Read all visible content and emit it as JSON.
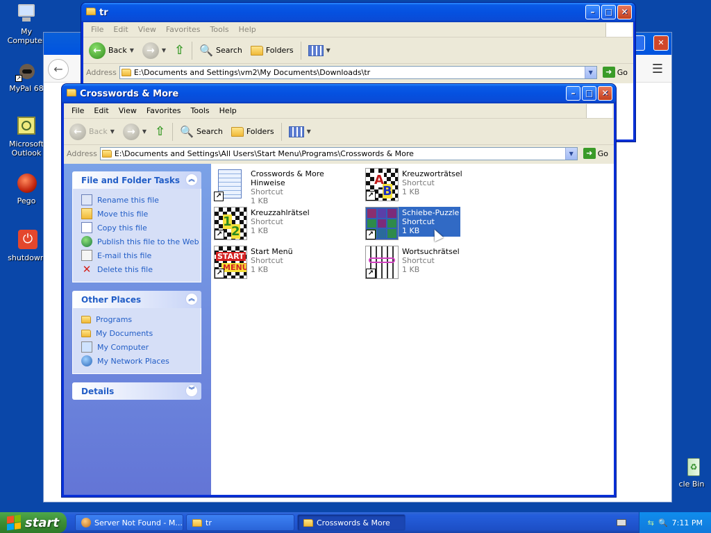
{
  "desktop": {
    "icons": [
      {
        "label": "My Computer"
      },
      {
        "label": "MyPal 68"
      },
      {
        "label": "Microsoft Outlook"
      },
      {
        "label": "Pego"
      },
      {
        "label": "shutdown"
      },
      {
        "label": "cle Bin"
      }
    ]
  },
  "tr_window": {
    "title": "tr",
    "menu": [
      "File",
      "Edit",
      "View",
      "Favorites",
      "Tools",
      "Help"
    ],
    "toolbar": {
      "back": "Back",
      "search": "Search",
      "folders": "Folders"
    },
    "address_label": "Address",
    "address": "E:\\Documents and Settings\\vm2\\My Documents\\Downloads\\tr",
    "go": "Go"
  },
  "main_window": {
    "title": "Crosswords & More",
    "menu": [
      "File",
      "Edit",
      "View",
      "Favorites",
      "Tools",
      "Help"
    ],
    "toolbar": {
      "back": "Back",
      "search": "Search",
      "folders": "Folders"
    },
    "address_label": "Address",
    "address": "E:\\Documents and Settings\\All Users\\Start Menu\\Programs\\Crosswords & More",
    "go": "Go",
    "tasks_panel": {
      "title": "File and Folder Tasks",
      "items": [
        "Rename this file",
        "Move this file",
        "Copy this file",
        "Publish this file to the Web",
        "E-mail this file",
        "Delete this file"
      ]
    },
    "places_panel": {
      "title": "Other Places",
      "items": [
        "Programs",
        "My Documents",
        "My Computer",
        "My Network Places"
      ]
    },
    "details_panel": {
      "title": "Details"
    },
    "files": [
      {
        "name": "Crosswords & More Hinweise",
        "type": "Shortcut",
        "size": "1 KB"
      },
      {
        "name": "Kreuzworträtsel",
        "type": "Shortcut",
        "size": "1 KB"
      },
      {
        "name": "Kreuzzahlrätsel",
        "type": "Shortcut",
        "size": "1 KB"
      },
      {
        "name": "Schiebe-Puzzle",
        "type": "Shortcut",
        "size": "1 KB"
      },
      {
        "name": "Start Menü",
        "type": "Shortcut",
        "size": "1 KB"
      },
      {
        "name": "Wortsuchrätsel",
        "type": "Shortcut",
        "size": "1 KB"
      }
    ]
  },
  "taskbar": {
    "start": "start",
    "tasks": [
      "Server Not Found - M...",
      "tr",
      "Crosswords & More"
    ],
    "clock": "7:11 PM"
  }
}
